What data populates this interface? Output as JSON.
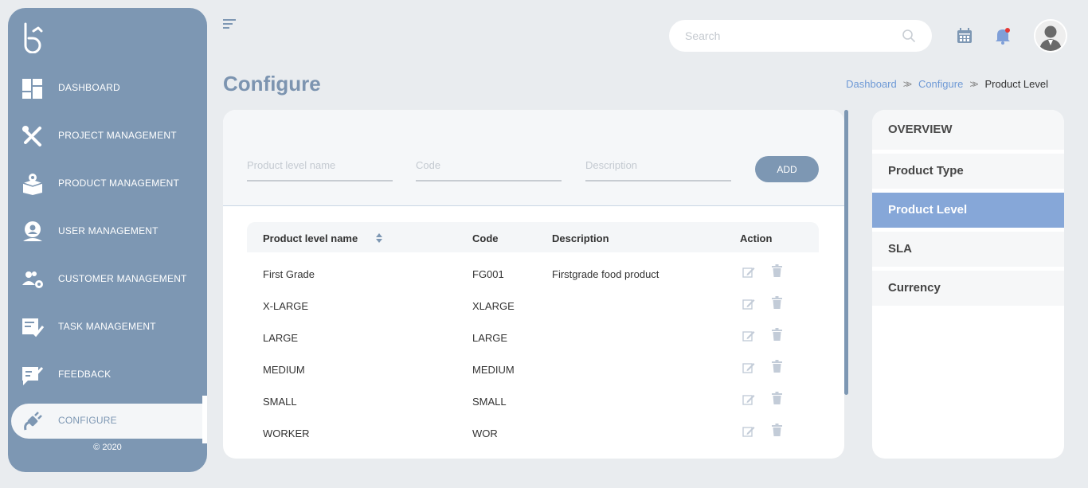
{
  "sidebar": {
    "items": [
      {
        "label": "DASHBOARD",
        "icon": "dashboard-icon"
      },
      {
        "label": "PROJECT MANAGEMENT",
        "icon": "tools-icon"
      },
      {
        "label": "PRODUCT MANAGEMENT",
        "icon": "box-gear-icon"
      },
      {
        "label": "USER MANAGEMENT",
        "icon": "user-gear-icon"
      },
      {
        "label": "CUSTOMER MANAGEMENT",
        "icon": "users-gear-icon"
      },
      {
        "label": "TASK MANAGEMENT",
        "icon": "task-check-icon"
      },
      {
        "label": "FEEDBACK",
        "icon": "feedback-icon"
      },
      {
        "label": "CONFIGURE",
        "icon": "plug-icon",
        "active": true
      }
    ],
    "copyright": "© 2020"
  },
  "topbar": {
    "search_placeholder": "Search"
  },
  "page": {
    "title": "Configure"
  },
  "breadcrumb": {
    "items": [
      "Dashboard",
      "Configure",
      "Product Level"
    ]
  },
  "form": {
    "name_placeholder": "Product level name",
    "code_placeholder": "Code",
    "description_placeholder": "Description",
    "add_label": "ADD"
  },
  "table": {
    "headers": [
      "Product level name",
      "Code",
      "Description",
      "Action"
    ],
    "rows": [
      {
        "name": "First Grade",
        "code": "FG001",
        "description": "Firstgrade food product"
      },
      {
        "name": "X-LARGE",
        "code": "XLARGE",
        "description": ""
      },
      {
        "name": "LARGE",
        "code": "LARGE",
        "description": ""
      },
      {
        "name": "MEDIUM",
        "code": "MEDIUM",
        "description": ""
      },
      {
        "name": "SMALL",
        "code": "SMALL",
        "description": ""
      },
      {
        "name": "WORKER",
        "code": "WOR",
        "description": ""
      }
    ]
  },
  "overview": {
    "title": "OVERVIEW",
    "items": [
      "Product Type",
      "Product Level",
      "SLA",
      "Currency"
    ],
    "active": "Product Level"
  },
  "colors": {
    "sidebar": "#7d97b3",
    "accent": "#86a7d8",
    "link": "#6f9ad6",
    "title": "#7c94b0",
    "notification_dot": "#e53935"
  }
}
